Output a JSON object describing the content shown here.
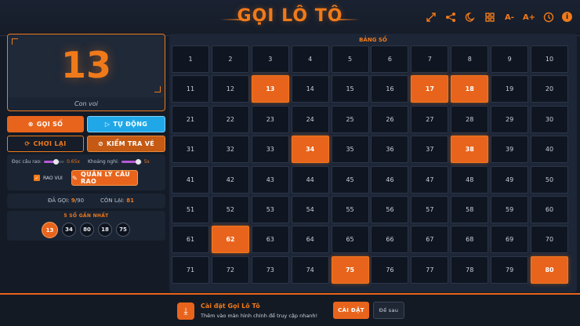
{
  "header": {
    "title": "GỌI LÔ TÔ",
    "tools": [
      "expand-icon",
      "share-icon",
      "moon-icon",
      "grid-icon",
      "font-decrease-icon",
      "font-increase-icon",
      "clock-icon",
      "info-icon"
    ],
    "font_decrease_label": "A-",
    "font_increase_label": "A+",
    "info_label": "i"
  },
  "display": {
    "current_number": "13",
    "caption": "Con voi"
  },
  "actions": {
    "call_label": "GỌI SỐ",
    "auto_label": "TỰ ĐỘNG",
    "reset_label": "CHƠI LẠI",
    "check_label": "KIỂM TRA VÉ"
  },
  "settings": {
    "speed_label": "Đọc câu rao:",
    "speed_value": "0.65x",
    "speed_level": 0.6,
    "interval_label": "Khoảng nghỉ:",
    "interval_value": "5s",
    "interval_level": 0.85,
    "rao_vui_label": "RAO VUI",
    "rao_vui_checked": true,
    "manage_label": "QUẢN LÝ CÂU RAO"
  },
  "stats": {
    "called_label": "ĐÃ GỌI:",
    "called_count": "9",
    "called_total": "/90",
    "remaining_label": "CÒN LẠI:",
    "remaining_count": "81"
  },
  "recent": {
    "title": "5 SỐ GẦN NHẤT",
    "numbers": [
      "13",
      "34",
      "80",
      "18",
      "75"
    ]
  },
  "board": {
    "title": "BẢNG SỐ",
    "numbers": [
      "1",
      "2",
      "3",
      "4",
      "5",
      "6",
      "7",
      "8",
      "9",
      "10",
      "11",
      "12",
      "13",
      "14",
      "15",
      "16",
      "17",
      "18",
      "19",
      "20",
      "21",
      "22",
      "23",
      "24",
      "25",
      "26",
      "27",
      "28",
      "29",
      "30",
      "31",
      "32",
      "33",
      "34",
      "35",
      "36",
      "37",
      "38",
      "39",
      "40",
      "41",
      "42",
      "43",
      "44",
      "45",
      "46",
      "47",
      "48",
      "49",
      "50",
      "51",
      "52",
      "53",
      "54",
      "55",
      "56",
      "57",
      "58",
      "59",
      "60",
      "61",
      "62",
      "63",
      "64",
      "65",
      "66",
      "67",
      "68",
      "69",
      "70",
      "71",
      "72",
      "73",
      "74",
      "75",
      "76",
      "77",
      "78",
      "79",
      "80"
    ],
    "called": [
      13,
      17,
      18,
      34,
      38,
      62,
      75,
      80
    ]
  },
  "install": {
    "title": "Cài đặt Gọi Lô Tô",
    "subtitle": "Thêm vào màn hình chính để truy cập nhanh!",
    "install_label": "CÀI ĐẶT",
    "later_label": "Để sau"
  },
  "colors": {
    "accent": "#e8641c",
    "auto_button": "#1fa7e8",
    "background": "#141b27"
  }
}
